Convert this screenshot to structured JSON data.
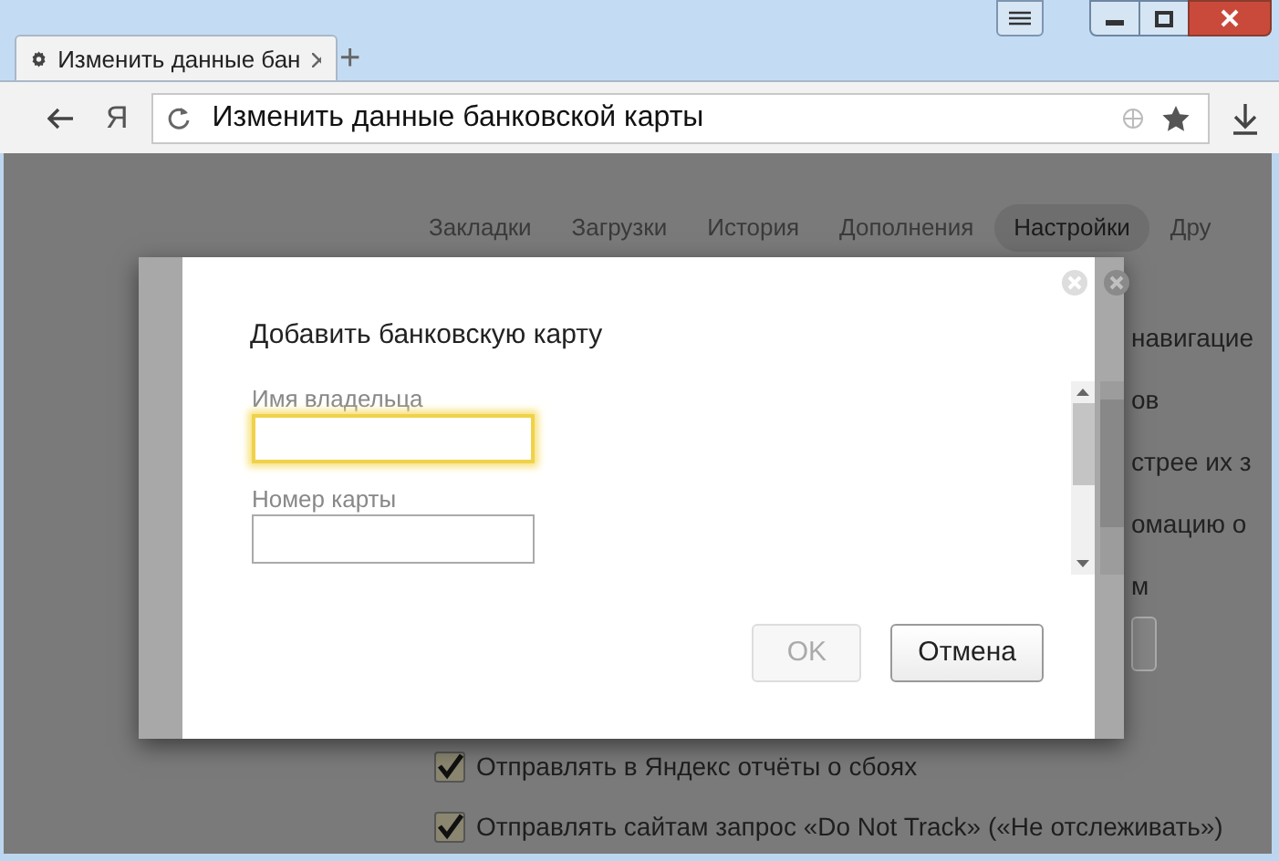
{
  "tab": {
    "title": "Изменить данные бан",
    "new_tab": "+"
  },
  "address_bar": {
    "logo": "Я",
    "value": "Изменить данные банковской карты"
  },
  "settings_page": {
    "nav": [
      {
        "label": "Закладки",
        "selected": false
      },
      {
        "label": "Загрузки",
        "selected": false
      },
      {
        "label": "История",
        "selected": false
      },
      {
        "label": "Дополнения",
        "selected": false
      },
      {
        "label": "Настройки",
        "selected": true
      },
      {
        "label": "Дру",
        "selected": false
      }
    ],
    "partial_texts": [
      "навигацие",
      "ов",
      "стрее их з",
      "омацию о",
      "м"
    ],
    "checkboxes": [
      {
        "label": "Отправлять в Яндекс отчёты о сбоях",
        "checked": true
      },
      {
        "label": "Отправлять сайтам запрос «Do Not Track» («Не отслеживать»)",
        "checked": true
      }
    ]
  },
  "dialog": {
    "title": "Добавить банковскую карту",
    "fields": [
      {
        "label": "Имя владельца",
        "focused": true
      },
      {
        "label": "Номер карты",
        "focused": false
      }
    ],
    "buttons": [
      {
        "label": "OK",
        "disabled": true
      },
      {
        "label": "Отмена",
        "disabled": false
      }
    ]
  }
}
